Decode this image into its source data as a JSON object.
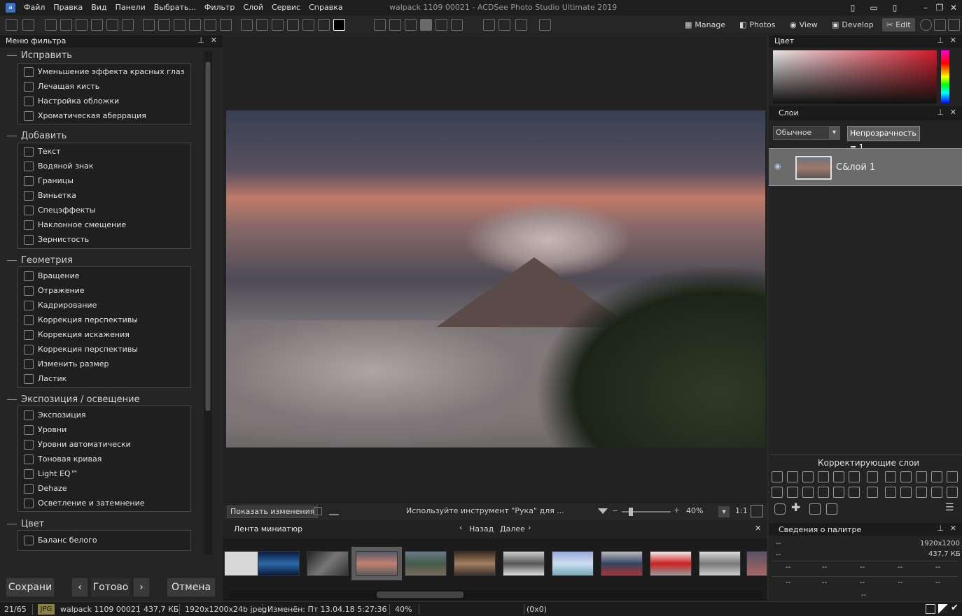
{
  "app": {
    "window_title": "walpack 1109 00021 - ACDSee Photo Studio Ultimate 2019",
    "menu": [
      "Файл",
      "Правка",
      "Вид",
      "Панели",
      "Выбрать...",
      "Фильтр",
      "Слой",
      "Сервис",
      "Справка"
    ]
  },
  "modes": [
    "Manage",
    "Photos",
    "View",
    "Develop",
    "Edit"
  ],
  "filter_menu": {
    "title": "Меню фильтра",
    "groups": [
      {
        "title": "Исправить",
        "items": [
          "Уменьшение эффекта красных глаз",
          "Лечащая кисть",
          "Настройка обложки",
          "Хроматическая аберрация"
        ]
      },
      {
        "title": "Добавить",
        "items": [
          "Текст",
          "Водяной знак",
          "Границы",
          "Виньетка",
          "Спецэффекты",
          "Наклонное смещение",
          "Зернистость"
        ]
      },
      {
        "title": "Геометрия",
        "items": [
          "Вращение",
          "Отражение",
          "Кадрирование",
          "Коррекция перспективы",
          "Коррекция искажения",
          "Коррекция перспективы",
          "Изменить размер",
          "Ластик"
        ]
      },
      {
        "title": "Экспозиция / освещение",
        "items": [
          "Экспозиция",
          "Уровни",
          "Уровни автоматически",
          "Тоновая кривая",
          "Light EQ™",
          "Dehaze",
          "Осветление и затемнение"
        ]
      },
      {
        "title": "Цвет",
        "items": [
          "Баланс белого"
        ]
      }
    ]
  },
  "bottom_buttons": {
    "save": "Сохрани",
    "done": "Готово",
    "cancel": "Отмена"
  },
  "canvas": {
    "show_changes": "Показать изменения",
    "hint": "Используйте инструмент \"Рука\" для ...",
    "zoom": "40%",
    "one_to_one": "1:1"
  },
  "filmstrip": {
    "title": "Лента миниатюр",
    "back": "Назад",
    "next": "Далее"
  },
  "right": {
    "color_title": "Цвет",
    "layers_title": "Слои",
    "blend_mode": "Обычное",
    "opacity": "Непрозрачность = 1",
    "layer_name": "С&лой 1",
    "adjustment_title": "Корректирующие слои",
    "info_title": "Сведения о палитре",
    "info_dims": "1920x1200",
    "info_size": "437,7 КБ",
    "dash": "--"
  },
  "status": {
    "count": "21/65",
    "type": "JPG",
    "file": "walpack 1109 00021",
    "size": "437,7 КБ",
    "dims": "1920x1200x24b jpeg",
    "modified": "Изменён: Пт 13.04.18 5:27:36",
    "zoom": "40%",
    "coords": "(0x0)"
  }
}
